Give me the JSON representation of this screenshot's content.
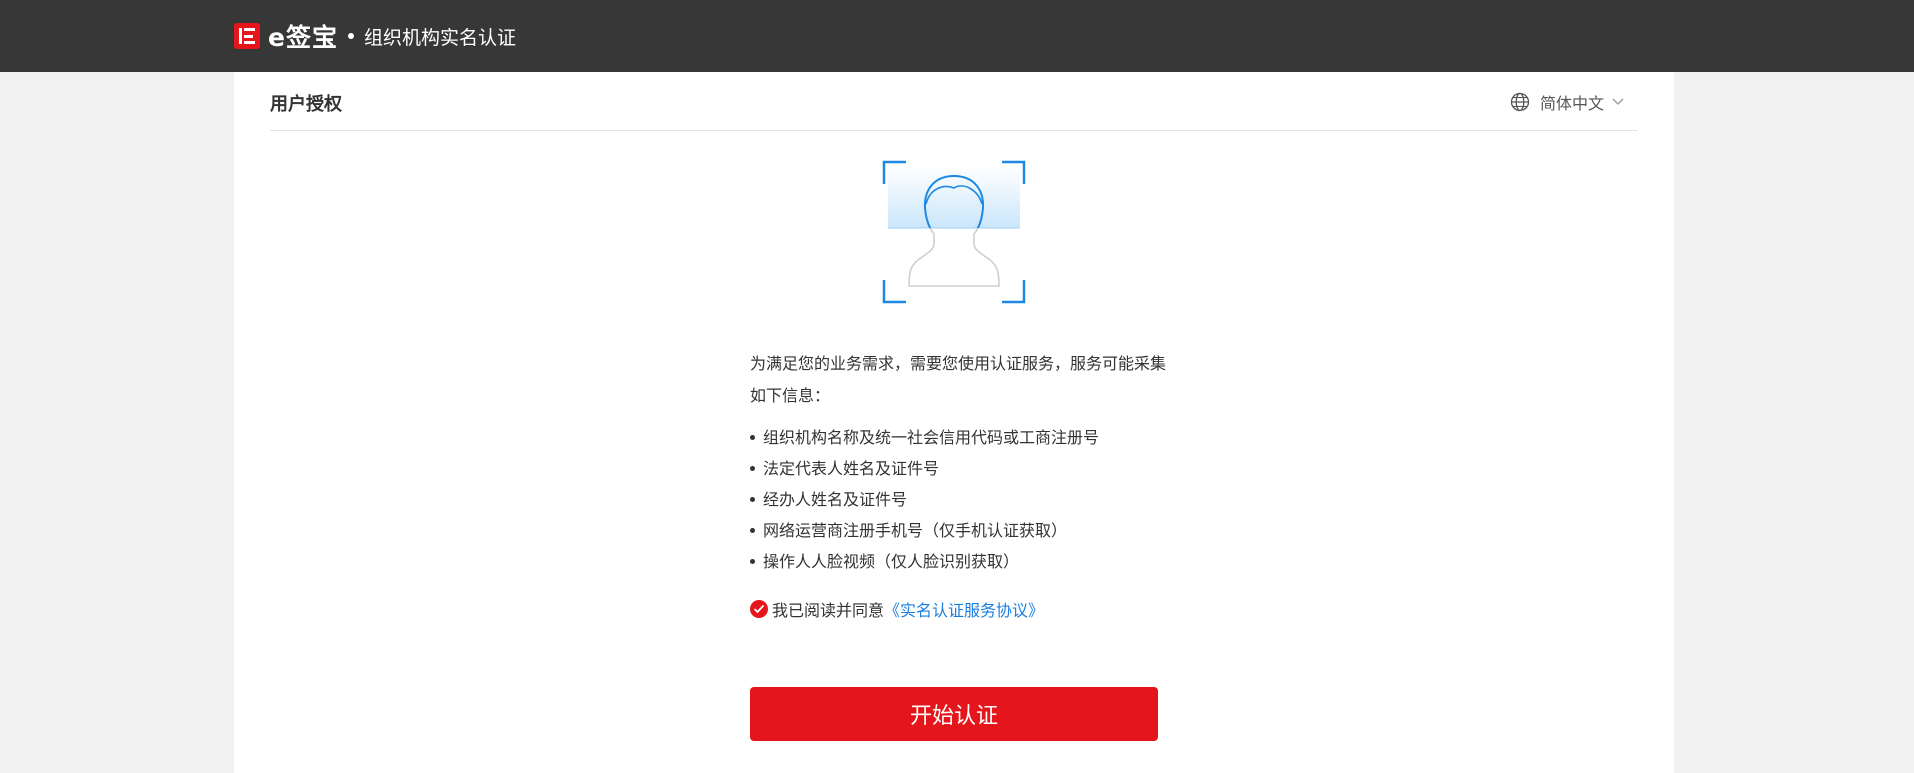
{
  "header": {
    "logo_text": "e签宝",
    "subtitle": "组织机构实名认证"
  },
  "panel": {
    "title": "用户授权",
    "language": {
      "label": "简体中文",
      "icon": "globe-icon"
    }
  },
  "illustration": {
    "icon": "face-scan-icon"
  },
  "content": {
    "intro": "为满足您的业务需求，需要您使用认证服务，服务可能采集如下信息：",
    "items": [
      "组织机构名称及统一社会信用代码或工商注册号",
      "法定代表人姓名及证件号",
      "经办人姓名及证件号",
      "网络运营商注册手机号（仅手机认证获取）",
      "操作人人脸视频（仅人脸识别获取）"
    ],
    "agree": {
      "text": "我已阅读并同意",
      "link": "《实名认证服务协议》",
      "checked": true
    },
    "start_button": "开始认证"
  },
  "colors": {
    "brand_red": "#e5161b",
    "topbar": "#373737",
    "link_blue": "#1a7ee0",
    "face_blue": "#1e88e5"
  }
}
